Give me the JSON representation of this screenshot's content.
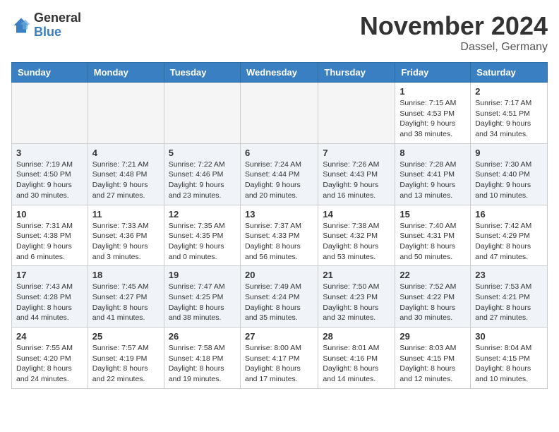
{
  "header": {
    "logo_general": "General",
    "logo_blue": "Blue",
    "month_title": "November 2024",
    "location": "Dassel, Germany"
  },
  "days_of_week": [
    "Sunday",
    "Monday",
    "Tuesday",
    "Wednesday",
    "Thursday",
    "Friday",
    "Saturday"
  ],
  "weeks": [
    [
      {
        "day": "",
        "info": ""
      },
      {
        "day": "",
        "info": ""
      },
      {
        "day": "",
        "info": ""
      },
      {
        "day": "",
        "info": ""
      },
      {
        "day": "",
        "info": ""
      },
      {
        "day": "1",
        "info": "Sunrise: 7:15 AM\nSunset: 4:53 PM\nDaylight: 9 hours\nand 38 minutes."
      },
      {
        "day": "2",
        "info": "Sunrise: 7:17 AM\nSunset: 4:51 PM\nDaylight: 9 hours\nand 34 minutes."
      }
    ],
    [
      {
        "day": "3",
        "info": "Sunrise: 7:19 AM\nSunset: 4:50 PM\nDaylight: 9 hours\nand 30 minutes."
      },
      {
        "day": "4",
        "info": "Sunrise: 7:21 AM\nSunset: 4:48 PM\nDaylight: 9 hours\nand 27 minutes."
      },
      {
        "day": "5",
        "info": "Sunrise: 7:22 AM\nSunset: 4:46 PM\nDaylight: 9 hours\nand 23 minutes."
      },
      {
        "day": "6",
        "info": "Sunrise: 7:24 AM\nSunset: 4:44 PM\nDaylight: 9 hours\nand 20 minutes."
      },
      {
        "day": "7",
        "info": "Sunrise: 7:26 AM\nSunset: 4:43 PM\nDaylight: 9 hours\nand 16 minutes."
      },
      {
        "day": "8",
        "info": "Sunrise: 7:28 AM\nSunset: 4:41 PM\nDaylight: 9 hours\nand 13 minutes."
      },
      {
        "day": "9",
        "info": "Sunrise: 7:30 AM\nSunset: 4:40 PM\nDaylight: 9 hours\nand 10 minutes."
      }
    ],
    [
      {
        "day": "10",
        "info": "Sunrise: 7:31 AM\nSunset: 4:38 PM\nDaylight: 9 hours\nand 6 minutes."
      },
      {
        "day": "11",
        "info": "Sunrise: 7:33 AM\nSunset: 4:36 PM\nDaylight: 9 hours\nand 3 minutes."
      },
      {
        "day": "12",
        "info": "Sunrise: 7:35 AM\nSunset: 4:35 PM\nDaylight: 9 hours\nand 0 minutes."
      },
      {
        "day": "13",
        "info": "Sunrise: 7:37 AM\nSunset: 4:33 PM\nDaylight: 8 hours\nand 56 minutes."
      },
      {
        "day": "14",
        "info": "Sunrise: 7:38 AM\nSunset: 4:32 PM\nDaylight: 8 hours\nand 53 minutes."
      },
      {
        "day": "15",
        "info": "Sunrise: 7:40 AM\nSunset: 4:31 PM\nDaylight: 8 hours\nand 50 minutes."
      },
      {
        "day": "16",
        "info": "Sunrise: 7:42 AM\nSunset: 4:29 PM\nDaylight: 8 hours\nand 47 minutes."
      }
    ],
    [
      {
        "day": "17",
        "info": "Sunrise: 7:43 AM\nSunset: 4:28 PM\nDaylight: 8 hours\nand 44 minutes."
      },
      {
        "day": "18",
        "info": "Sunrise: 7:45 AM\nSunset: 4:27 PM\nDaylight: 8 hours\nand 41 minutes."
      },
      {
        "day": "19",
        "info": "Sunrise: 7:47 AM\nSunset: 4:25 PM\nDaylight: 8 hours\nand 38 minutes."
      },
      {
        "day": "20",
        "info": "Sunrise: 7:49 AM\nSunset: 4:24 PM\nDaylight: 8 hours\nand 35 minutes."
      },
      {
        "day": "21",
        "info": "Sunrise: 7:50 AM\nSunset: 4:23 PM\nDaylight: 8 hours\nand 32 minutes."
      },
      {
        "day": "22",
        "info": "Sunrise: 7:52 AM\nSunset: 4:22 PM\nDaylight: 8 hours\nand 30 minutes."
      },
      {
        "day": "23",
        "info": "Sunrise: 7:53 AM\nSunset: 4:21 PM\nDaylight: 8 hours\nand 27 minutes."
      }
    ],
    [
      {
        "day": "24",
        "info": "Sunrise: 7:55 AM\nSunset: 4:20 PM\nDaylight: 8 hours\nand 24 minutes."
      },
      {
        "day": "25",
        "info": "Sunrise: 7:57 AM\nSunset: 4:19 PM\nDaylight: 8 hours\nand 22 minutes."
      },
      {
        "day": "26",
        "info": "Sunrise: 7:58 AM\nSunset: 4:18 PM\nDaylight: 8 hours\nand 19 minutes."
      },
      {
        "day": "27",
        "info": "Sunrise: 8:00 AM\nSunset: 4:17 PM\nDaylight: 8 hours\nand 17 minutes."
      },
      {
        "day": "28",
        "info": "Sunrise: 8:01 AM\nSunset: 4:16 PM\nDaylight: 8 hours\nand 14 minutes."
      },
      {
        "day": "29",
        "info": "Sunrise: 8:03 AM\nSunset: 4:15 PM\nDaylight: 8 hours\nand 12 minutes."
      },
      {
        "day": "30",
        "info": "Sunrise: 8:04 AM\nSunset: 4:15 PM\nDaylight: 8 hours\nand 10 minutes."
      }
    ]
  ]
}
